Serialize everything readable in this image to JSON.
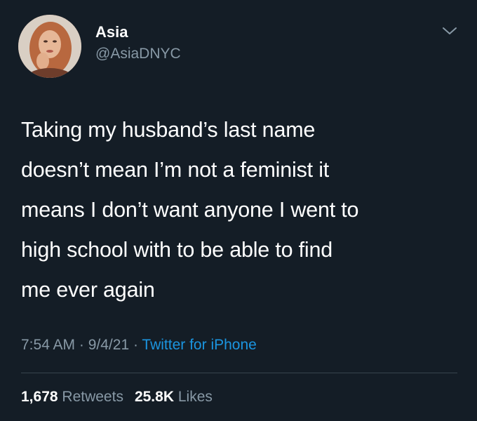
{
  "user": {
    "display_name": "Asia",
    "handle": "@AsiaDNYC"
  },
  "tweet": {
    "text": "Taking my husband’s last name\ndoesn’t mean I’m not a feminist it\nmeans I don’t want anyone I went to\nhigh school with to be able to find\nme ever again",
    "time": "7:54 AM",
    "separator": " · ",
    "date": "9/4/21",
    "source": "Twitter for iPhone"
  },
  "stats": {
    "retweets_count": "1,678",
    "retweets_label": "Retweets",
    "likes_count": "25.8K",
    "likes_label": "Likes"
  },
  "icons": {
    "menu": "chevron-down-icon"
  },
  "colors": {
    "background": "#141d26",
    "text": "#ffffff",
    "secondary": "#8899a6",
    "link": "#1b95e0",
    "divider": "#38444d"
  }
}
